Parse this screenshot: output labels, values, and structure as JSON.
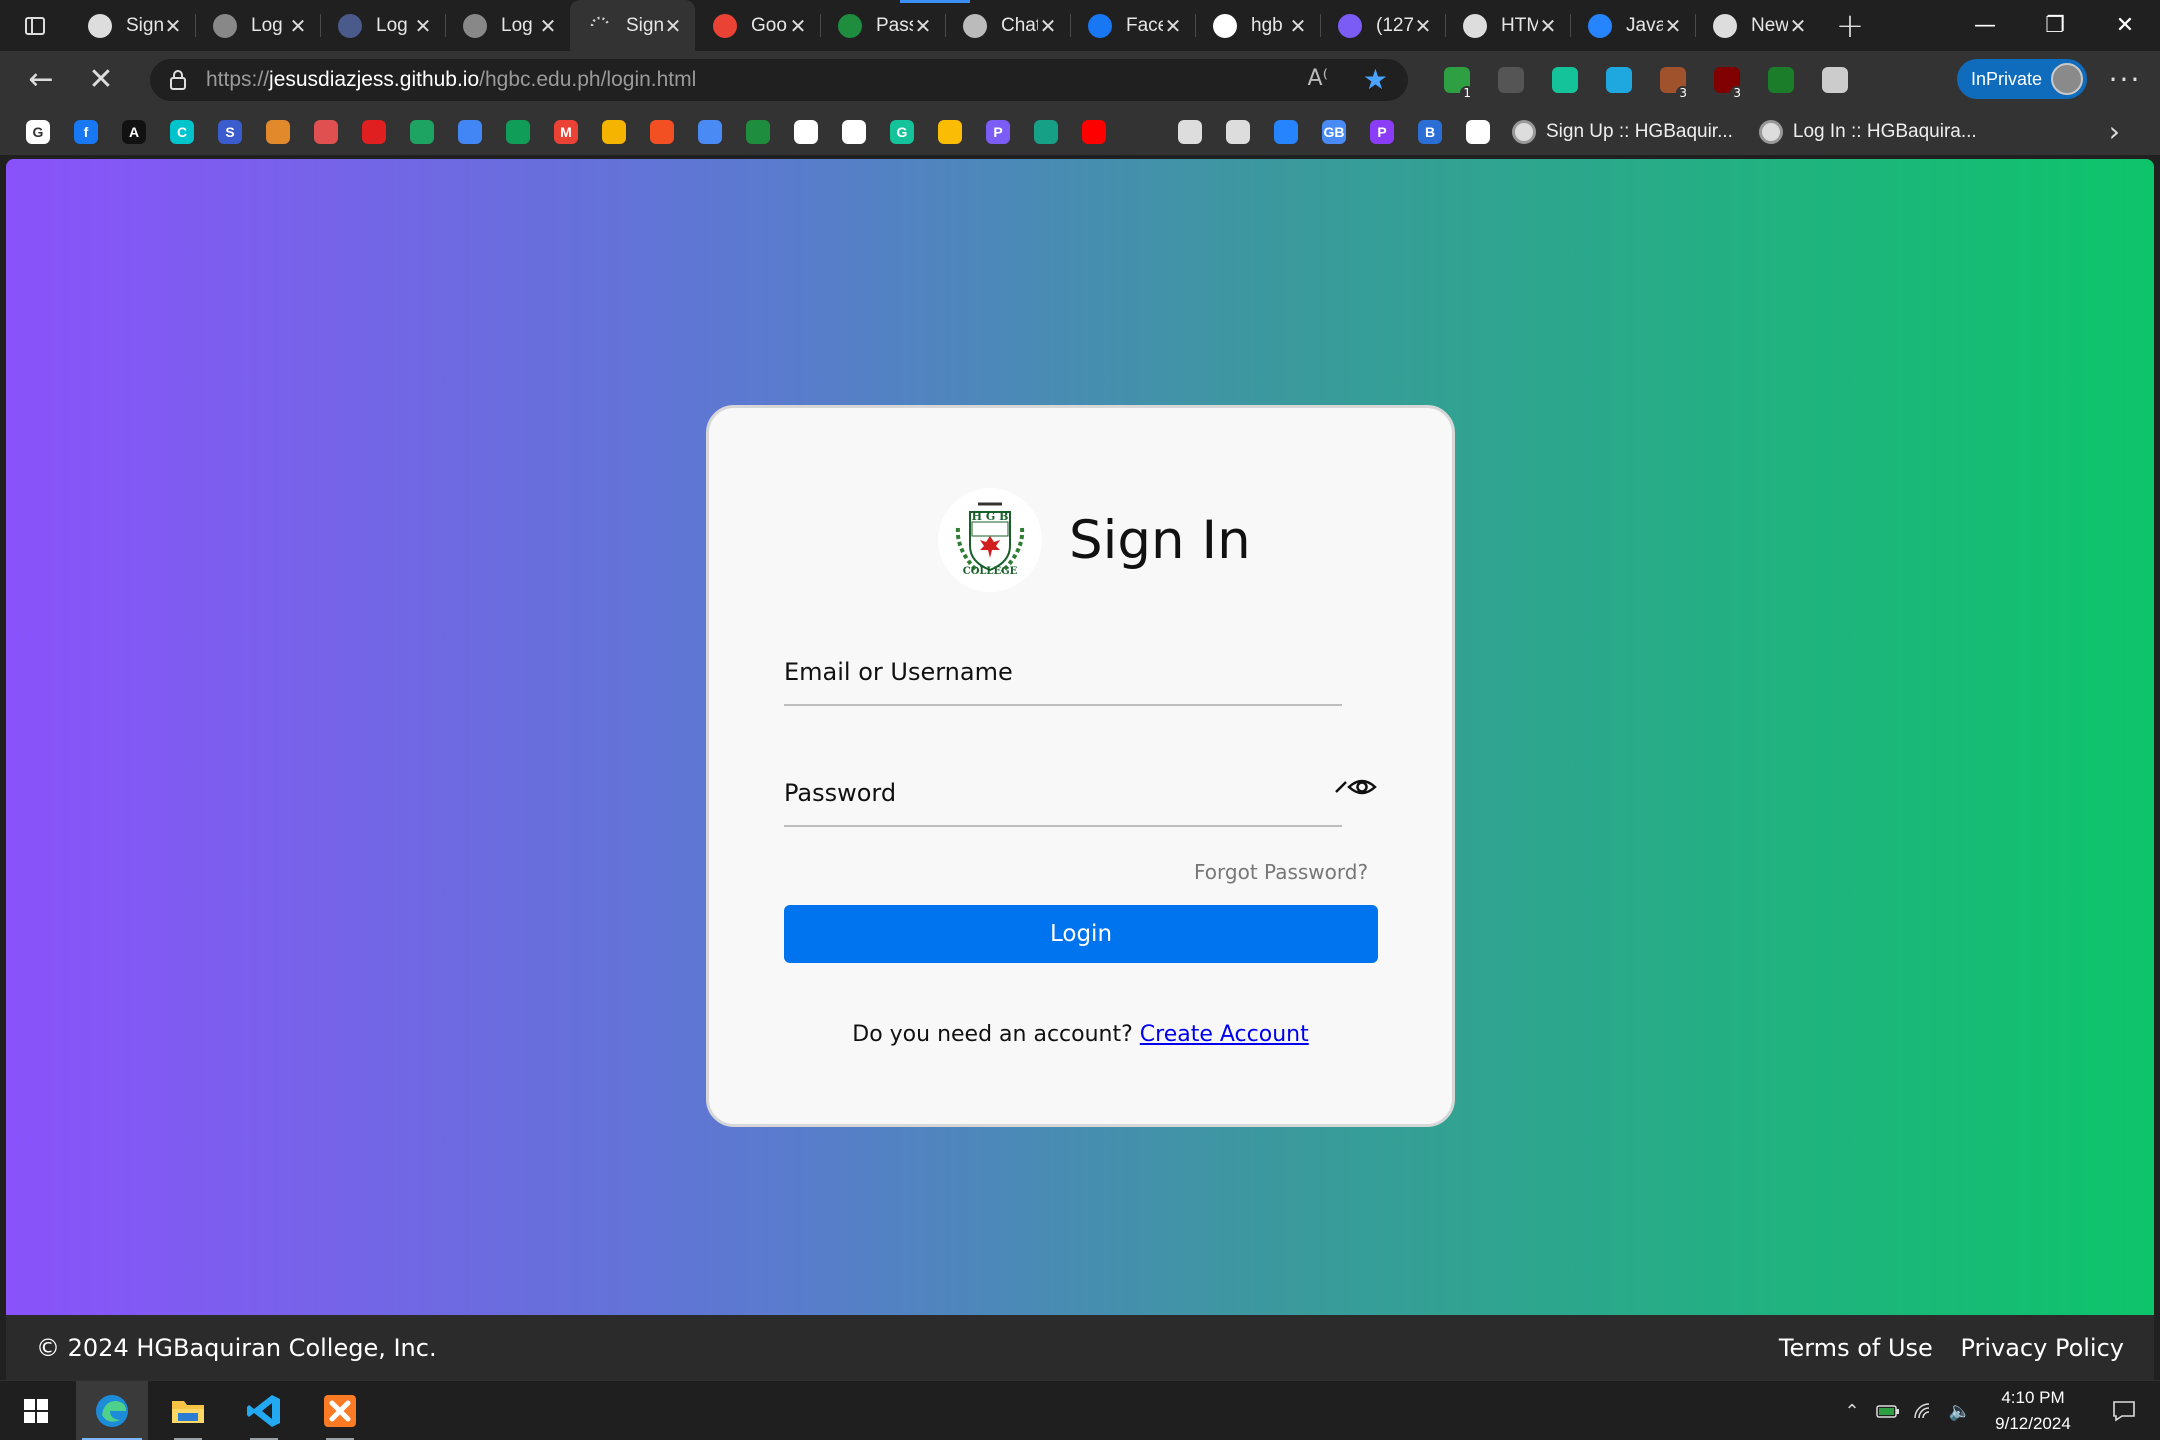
{
  "browser": {
    "tabs": [
      {
        "title": "Sign",
        "icon": "hgb-logo-icon",
        "color": "#dddddd"
      },
      {
        "title": "Log",
        "icon": "hgb-logo-icon",
        "color": "#888888"
      },
      {
        "title": "Log",
        "icon": "jw-icon",
        "color": "#4a5a8a"
      },
      {
        "title": "Log",
        "icon": "hgb-logo-icon",
        "color": "#888888"
      },
      {
        "title": "Sign",
        "icon": "loading-spinner-icon",
        "color": "#cccccc",
        "active": true
      },
      {
        "title": "Goo",
        "icon": "google-icon",
        "color": "#ea4335"
      },
      {
        "title": "Pass",
        "icon": "sheets-icon",
        "color": "#1e8e3e"
      },
      {
        "title": "Chat",
        "icon": "chatgpt-icon",
        "color": "#bbbbbb"
      },
      {
        "title": "Face",
        "icon": "facebook-icon",
        "color": "#1877f2"
      },
      {
        "title": "hgb",
        "icon": "github-icon",
        "color": "#ffffff"
      },
      {
        "title": "(127",
        "icon": "mail-icon",
        "color": "#7b5cf5"
      },
      {
        "title": "HTM",
        "icon": "file-icon",
        "color": "#dddddd"
      },
      {
        "title": "Java",
        "icon": "jira-icon",
        "color": "#2684ff"
      },
      {
        "title": "New",
        "icon": "newtab-icon",
        "color": "#dddddd"
      }
    ],
    "url_prefix": "https://",
    "url_host": "jesusdiazjess.github.io",
    "url_path": "/hgbc.edu.ph/login.html",
    "inprivate_label": "InPrivate",
    "extensions": [
      {
        "icon": "shield-extension-icon",
        "color": "#2ea043",
        "badge": "1"
      },
      {
        "icon": "reader-extension-icon",
        "color": "#555555",
        "badge": ""
      },
      {
        "icon": "grammarly-icon",
        "color": "#15c39a",
        "badge": ""
      },
      {
        "icon": "download-extension-icon",
        "color": "#1fa7e0",
        "badge": ""
      },
      {
        "icon": "cookie-extension-icon",
        "color": "#a0522d",
        "badge": "3"
      },
      {
        "icon": "ublock-icon",
        "color": "#800000",
        "badge": "3"
      },
      {
        "icon": "leaf-extension-icon",
        "color": "#1b7d2a",
        "badge": ""
      },
      {
        "icon": "extensions-puzzle-icon",
        "color": "#cccccc",
        "badge": ""
      }
    ],
    "favorites": [
      {
        "icon": "google-icon",
        "color": "#ffffff",
        "glyph": "G"
      },
      {
        "icon": "facebook-icon",
        "color": "#1877f2",
        "glyph": "f"
      },
      {
        "icon": "adobe-icon",
        "color": "#111111",
        "glyph": "A"
      },
      {
        "icon": "canva-icon",
        "color": "#00c4cc",
        "glyph": "C"
      },
      {
        "icon": "sheets-s-icon",
        "color": "#3a5ccc",
        "glyph": "S"
      },
      {
        "icon": "burger-icon",
        "color": "#e28a2b",
        "glyph": ""
      },
      {
        "icon": "cloud-icon",
        "color": "#e05050",
        "glyph": ""
      },
      {
        "icon": "heart-icon",
        "color": "#e02020",
        "glyph": ""
      },
      {
        "icon": "drive-icon",
        "color": "#1da462",
        "glyph": ""
      },
      {
        "icon": "docs-icon",
        "color": "#4285f4",
        "glyph": ""
      },
      {
        "icon": "sheets-icon",
        "color": "#0f9d58",
        "glyph": ""
      },
      {
        "icon": "gmail-icon",
        "color": "#ea4335",
        "glyph": "M"
      },
      {
        "icon": "keep-icon",
        "color": "#f4b400",
        "glyph": ""
      },
      {
        "icon": "microsoft-icon",
        "color": "#f25022",
        "glyph": ""
      },
      {
        "icon": "gemini-icon",
        "color": "#4a8af4",
        "glyph": ""
      },
      {
        "icon": "classroom-icon",
        "color": "#1e8e3e",
        "glyph": ""
      },
      {
        "icon": "chatgpt-icon",
        "color": "#ffffff",
        "glyph": ""
      },
      {
        "icon": "eye-bookmark-icon",
        "color": "#ffffff",
        "glyph": ""
      },
      {
        "icon": "grammarly-icon",
        "color": "#15c39a",
        "glyph": "G"
      },
      {
        "icon": "photos-icon",
        "color": "#fbbc05",
        "glyph": ""
      },
      {
        "icon": "p-icon",
        "color": "#7b5cf5",
        "glyph": "P"
      },
      {
        "icon": "globe-icon",
        "color": "#16a085",
        "glyph": ""
      },
      {
        "icon": "youtube-icon",
        "color": "#ff0000",
        "glyph": ""
      },
      {
        "icon": "dark-app-icon",
        "color": "#333333",
        "glyph": ""
      },
      {
        "icon": "hgb-logo-icon",
        "color": "#dddddd",
        "glyph": ""
      },
      {
        "icon": "file-icon",
        "color": "#dddddd",
        "glyph": ""
      },
      {
        "icon": "jira-icon",
        "color": "#2684ff",
        "glyph": ""
      },
      {
        "icon": "gb-icon",
        "color": "#4a8af4",
        "glyph": "GB"
      },
      {
        "icon": "p-purple-icon",
        "color": "#8b3cf7",
        "glyph": "P"
      },
      {
        "icon": "b-icon",
        "color": "#2b6fd6",
        "glyph": "B"
      },
      {
        "icon": "github-icon",
        "color": "#ffffff",
        "glyph": ""
      }
    ],
    "favorite_links": [
      "Sign Up :: HGBaquir...",
      "Log In :: HGBaquira..."
    ]
  },
  "card": {
    "title": "Sign In",
    "logo_top": "H G B",
    "logo_bottom": "COLLEGE",
    "email_label": "Email or Username",
    "password_label": "Password",
    "forgot_label": "Forgot Password?",
    "login_label": "Login",
    "signup_prompt": "Do you need an account?",
    "signup_link": "Create Account"
  },
  "footer": {
    "copyright": "© 2024 HGBaquiran College, Inc.",
    "terms": "Terms of Use",
    "privacy": "Privacy Policy"
  },
  "taskbar": {
    "time": "4:10 PM",
    "date": "9/12/2024",
    "apps": [
      {
        "icon": "edge-icon",
        "active": true
      },
      {
        "icon": "file-explorer-icon",
        "active": false
      },
      {
        "icon": "vscode-icon",
        "active": false
      },
      {
        "icon": "xampp-icon",
        "active": false
      }
    ]
  }
}
